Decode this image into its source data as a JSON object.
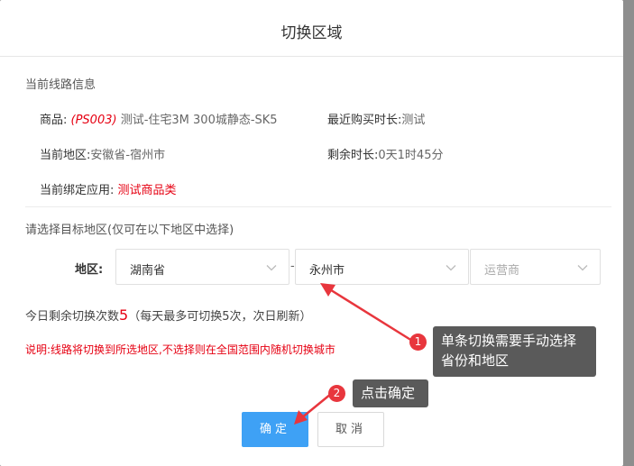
{
  "dialog": {
    "title": "切换区域",
    "current_section_title": "当前线路信息",
    "product_label": "商品: ",
    "product_code": "(PS003)",
    "product_name": " 测试-住宅3M 300城静态-SK5",
    "recent_duration_label": "最近购买时长:",
    "recent_duration_value": "测试",
    "current_region_label": "当前地区:",
    "current_region_value": "安徽省-宿州市",
    "remaining_time_label": "剩余时长:",
    "remaining_time_value": "0天1时45分",
    "bound_app_label": "当前绑定应用: ",
    "bound_app_value": "测试商品类",
    "target_section_title": "请选择目标地区(仅可在以下地区中选择)",
    "region_label": "地区:",
    "province_value": "湖南省",
    "separator": "-",
    "city_value": "永州市",
    "operator_placeholder": "运营商",
    "remaining_prefix": "今日剩余切换次数",
    "remaining_count": "5",
    "remaining_suffix": "（每天最多可切换5次，次日刷新）",
    "note": "说明:线路将切换到所选地区,不选择则在全国范围内随机切换城市",
    "ok_label": "确定",
    "cancel_label": "取消"
  },
  "annotations": {
    "badge1": "1",
    "tip1_line1": "单条切换需要手动选择",
    "tip1_line2": "省份和地区",
    "badge2": "2",
    "tip2": "点击确定"
  },
  "colors": {
    "primary": "#3ea1f5",
    "danger": "#e60012",
    "annotation_badge": "#e8363d",
    "annotation_tip": "#5a5a5a"
  }
}
